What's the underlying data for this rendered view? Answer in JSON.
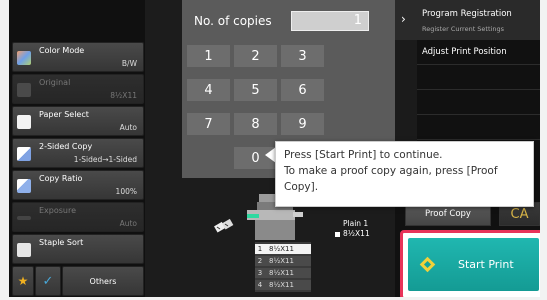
{
  "left_functions": [
    {
      "label": "Color Mode",
      "value": "B/W",
      "icon": "color-mode-icon",
      "enabled": true,
      "icon_color": "#8aa8e0"
    },
    {
      "label": "Original",
      "value": "8½X11",
      "icon": "original-icon",
      "enabled": false,
      "icon_color": "#555555"
    },
    {
      "label": "Paper Select",
      "value": "Auto",
      "icon": "paper-icon",
      "enabled": true,
      "icon_color": "#f0f0f0"
    },
    {
      "label": "2-Sided Copy",
      "value": "1-Sided→1-Sided",
      "icon": "duplex-icon",
      "enabled": true,
      "icon_color": "#9ab5e8"
    },
    {
      "label": "Copy Ratio",
      "value": "100%",
      "icon": "ratio-icon",
      "enabled": true,
      "icon_color": "#c8d6f2"
    },
    {
      "label": "Exposure",
      "value": "Auto",
      "icon": "exposure-icon",
      "enabled": false,
      "icon_color": "#555555"
    },
    {
      "label": "Staple Sort",
      "value": "",
      "icon": "staple-icon",
      "enabled": true,
      "icon_color": "#e0e0e0"
    }
  ],
  "bottom_buttons": {
    "others_label": "Others"
  },
  "copies": {
    "label": "No. of copies",
    "value": "1"
  },
  "keypad": [
    "1",
    "2",
    "3",
    "4",
    "5",
    "6",
    "7",
    "8",
    "9",
    "0"
  ],
  "output": {
    "tray_label": "Plain 1",
    "tray_size": "8½X11"
  },
  "trays": [
    {
      "num": "1",
      "size": "8½X11"
    },
    {
      "num": "2",
      "size": "8½X11"
    },
    {
      "num": "3",
      "size": "8½X11"
    },
    {
      "num": "4",
      "size": "8½X11"
    }
  ],
  "tooltip": {
    "line1": "Press [Start Print] to continue.",
    "line2": "To make a proof copy again, press [Proof",
    "line3": "Copy]."
  },
  "right_panel": {
    "program_registration": "Program Registration",
    "register_current_settings": "Register Current Settings",
    "adjust_print_position": "Adjust Print Position",
    "proof_copy": "Proof Copy",
    "ca": "CA",
    "start_print": "Start Print"
  },
  "colors": {
    "start_button": "#1aaaa3",
    "highlight_border": "#e8335a",
    "ca_text": "#d7b447"
  }
}
